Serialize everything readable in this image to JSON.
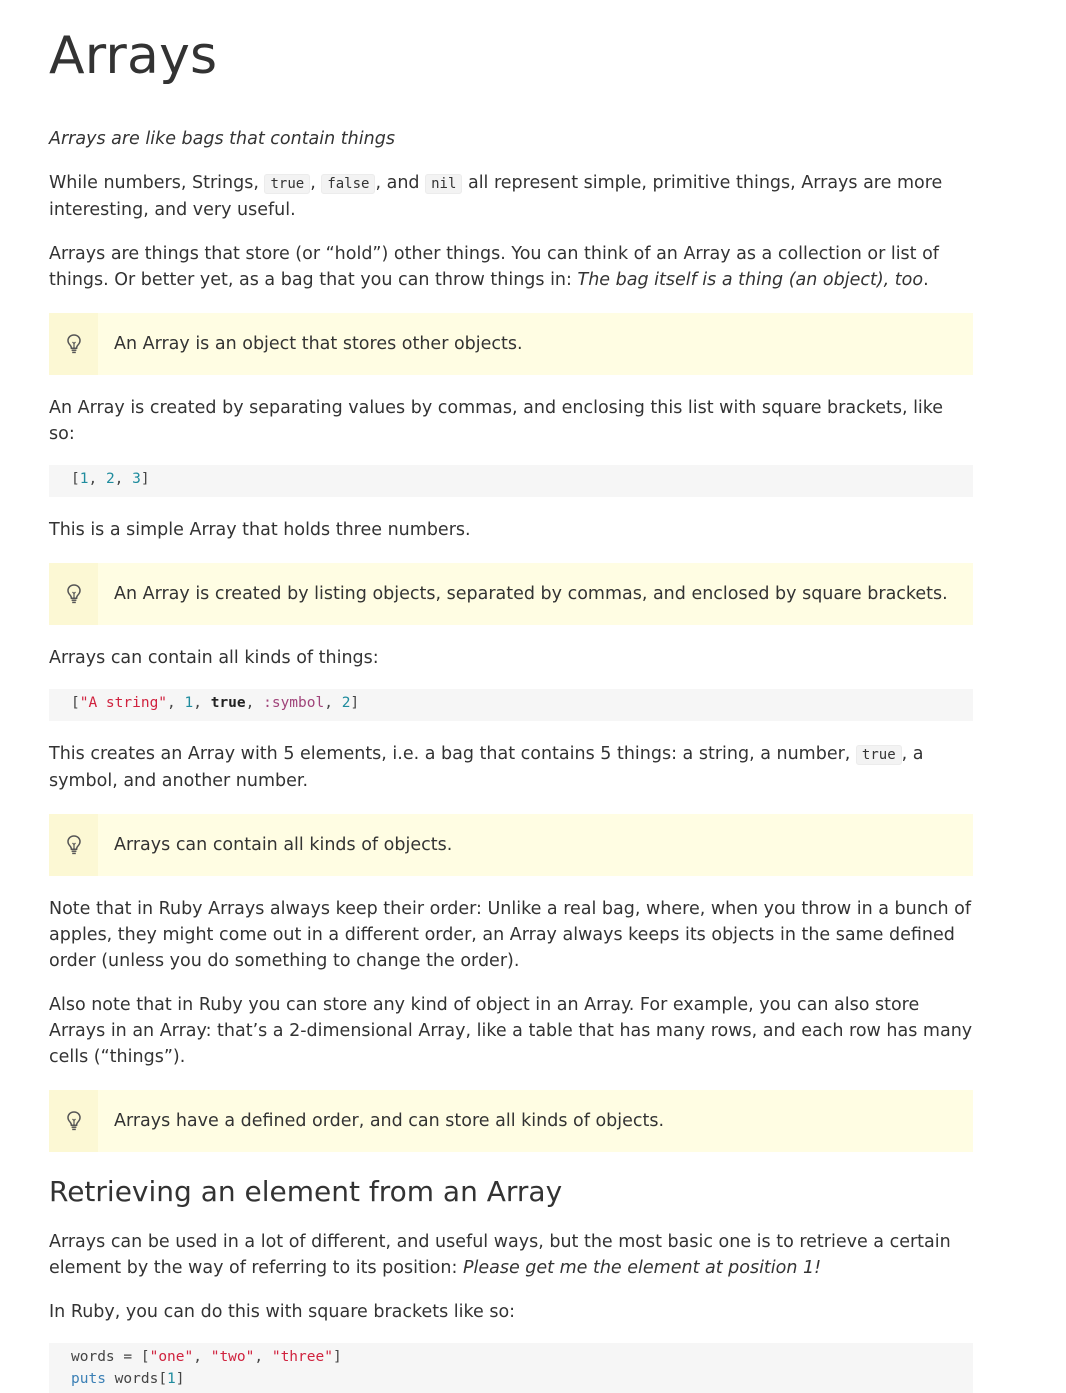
{
  "page": {
    "title": "Arrays",
    "subtitle": "Arrays are like bags that contain things",
    "p1": {
      "a": "While numbers, Strings, ",
      "code1": "true",
      "b": ", ",
      "code2": "false",
      "c": ", and ",
      "code3": "nil",
      "d": " all represent simple, primitive things, Arrays are more interesting, and very useful."
    },
    "p2": {
      "a": "Arrays are things that store (or “hold”) other things. You can think of an Array as a collection or list of things. Or better yet, as a bag that you can throw things in: ",
      "em": "The bag itself is a thing (an object), too",
      "b": "."
    },
    "callout1": "An Array is an object that stores other objects.",
    "p3": "An Array is created by separating values by commas, and enclosing this list with square brackets, like so:",
    "code1": {
      "open": "[",
      "n1": "1",
      "sep1": ", ",
      "n2": "2",
      "sep2": ", ",
      "n3": "3",
      "close": "]"
    },
    "p4": "This is a simple Array that holds three numbers.",
    "callout2": "An Array is created by listing objects, separated by commas, and enclosed by square brackets.",
    "p5": "Arrays can contain all kinds of things:",
    "code2": {
      "open": "[",
      "s1": "\"A string\"",
      "sep1": ", ",
      "n1": "1",
      "sep2": ", ",
      "kw": "true",
      "sep3": ", ",
      "sym": ":symbol",
      "sep4": ", ",
      "n2": "2",
      "close": "]"
    },
    "p6": {
      "a": "This creates an Array with 5 elements, i.e. a bag that contains 5 things: a string, a number, ",
      "code": "true",
      "b": ", a symbol, and another number."
    },
    "callout3": "Arrays can contain all kinds of objects.",
    "p7": "Note that in Ruby Arrays always keep their order: Unlike a real bag, where, when you throw in a bunch of apples, they might come out in a different order, an Array always keeps its objects in the same defined order (unless you do something to change the order).",
    "p8": "Also note that in Ruby you can store any kind of object in an Array. For example, you can also store Arrays in an Array: that’s a 2-dimensional Array, like a table that has many rows, and each row has many cells (“things”).",
    "callout4": "Arrays have a defined order, and can store all kinds of objects.",
    "h2": "Retrieving an element from an Array",
    "p9": {
      "a": "Arrays can be used in a lot of different, and useful ways, but the most basic one is to retrieve a certain element by the way of referring to its position: ",
      "em": "Please get me the element at position 1!"
    },
    "p10": "In Ruby, you can do this with square brackets like so:",
    "code3": {
      "l1_var": "words",
      "l1_eq": " = ",
      "l1_open": "[",
      "l1_s1": "\"one\"",
      "l1_sep1": ", ",
      "l1_s2": "\"two\"",
      "l1_sep2": ", ",
      "l1_s3": "\"three\"",
      "l1_close": "]",
      "l2_fn": "puts",
      "l2_sp": " ",
      "l2_var": "words",
      "l2_open": "[",
      "l2_n": "1",
      "l2_close": "]"
    }
  },
  "icons": {
    "callout": "lightbulb-icon"
  },
  "colors": {
    "callout_bg": "#fffde3",
    "callout_icon_bg": "#fcf8d4",
    "code_bg": "#f6f6f6",
    "number": "#1f8c9e",
    "string": "#d0223e",
    "symbol": "#a0447a",
    "builtin": "#3a7fb5"
  }
}
